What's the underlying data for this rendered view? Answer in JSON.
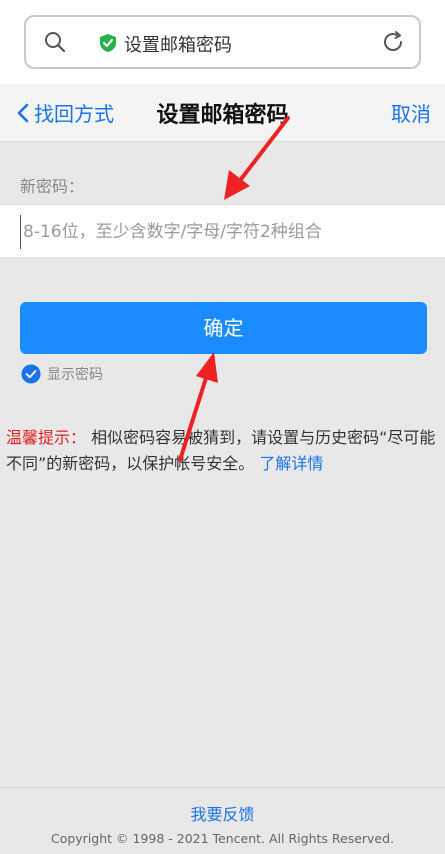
{
  "browser": {
    "url_text": "设置邮箱密码"
  },
  "nav": {
    "back_label": "找回方式",
    "title": "设置邮箱密码",
    "cancel_label": "取消"
  },
  "form": {
    "label": "新密码：",
    "placeholder": "8-16位，至少含数字/字母/字符2种组合",
    "value": "",
    "confirm_label": "确定",
    "show_password_label": "显示密码",
    "show_password_checked": true
  },
  "tip": {
    "title": "温馨提示：",
    "text": "相似密码容易被猜到，请设置与历史密码“尽可能不同”的新密码，以保护帐号安全。",
    "link": "了解详情"
  },
  "footer": {
    "feedback": "我要反馈",
    "copyright": "Copyright © 1998 - 2021 Tencent. All Rights Reserved."
  },
  "colors": {
    "accent": "#1a8cff",
    "link": "#1a73e8",
    "warning": "#e02020",
    "annotation_arrow": "#ee2222"
  }
}
